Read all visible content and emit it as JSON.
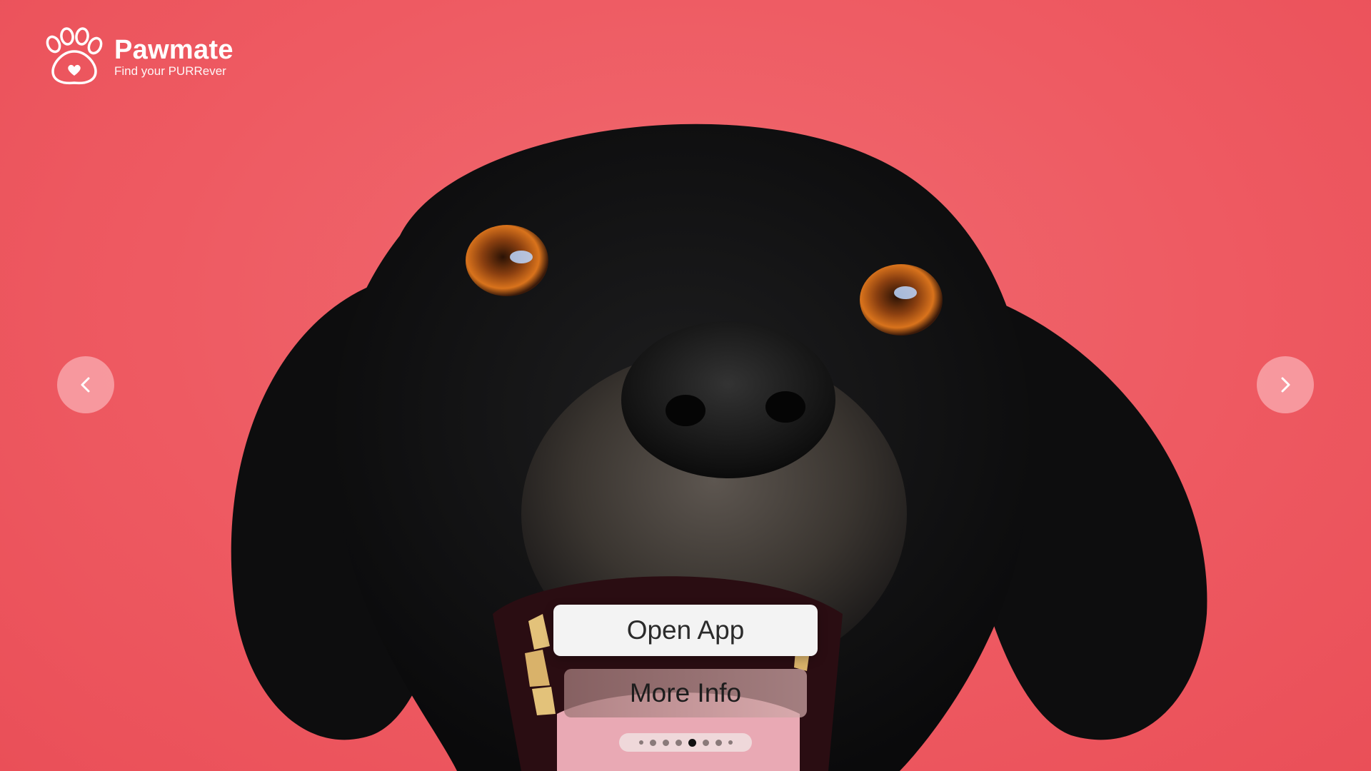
{
  "brand": {
    "name": "Pawmate",
    "tagline": "Find your PURRever",
    "logo_icon": "paw-heart-icon"
  },
  "navigation": {
    "prev_icon": "chevron-left-icon",
    "next_icon": "chevron-right-icon"
  },
  "actions": {
    "open_app_label": "Open App",
    "more_info_label": "More Info"
  },
  "pagination": {
    "total": 8,
    "current": 5
  },
  "colors": {
    "background": "#ee5a62",
    "button_light": "#f3f3f3",
    "text_dark": "#2b2b2b"
  }
}
